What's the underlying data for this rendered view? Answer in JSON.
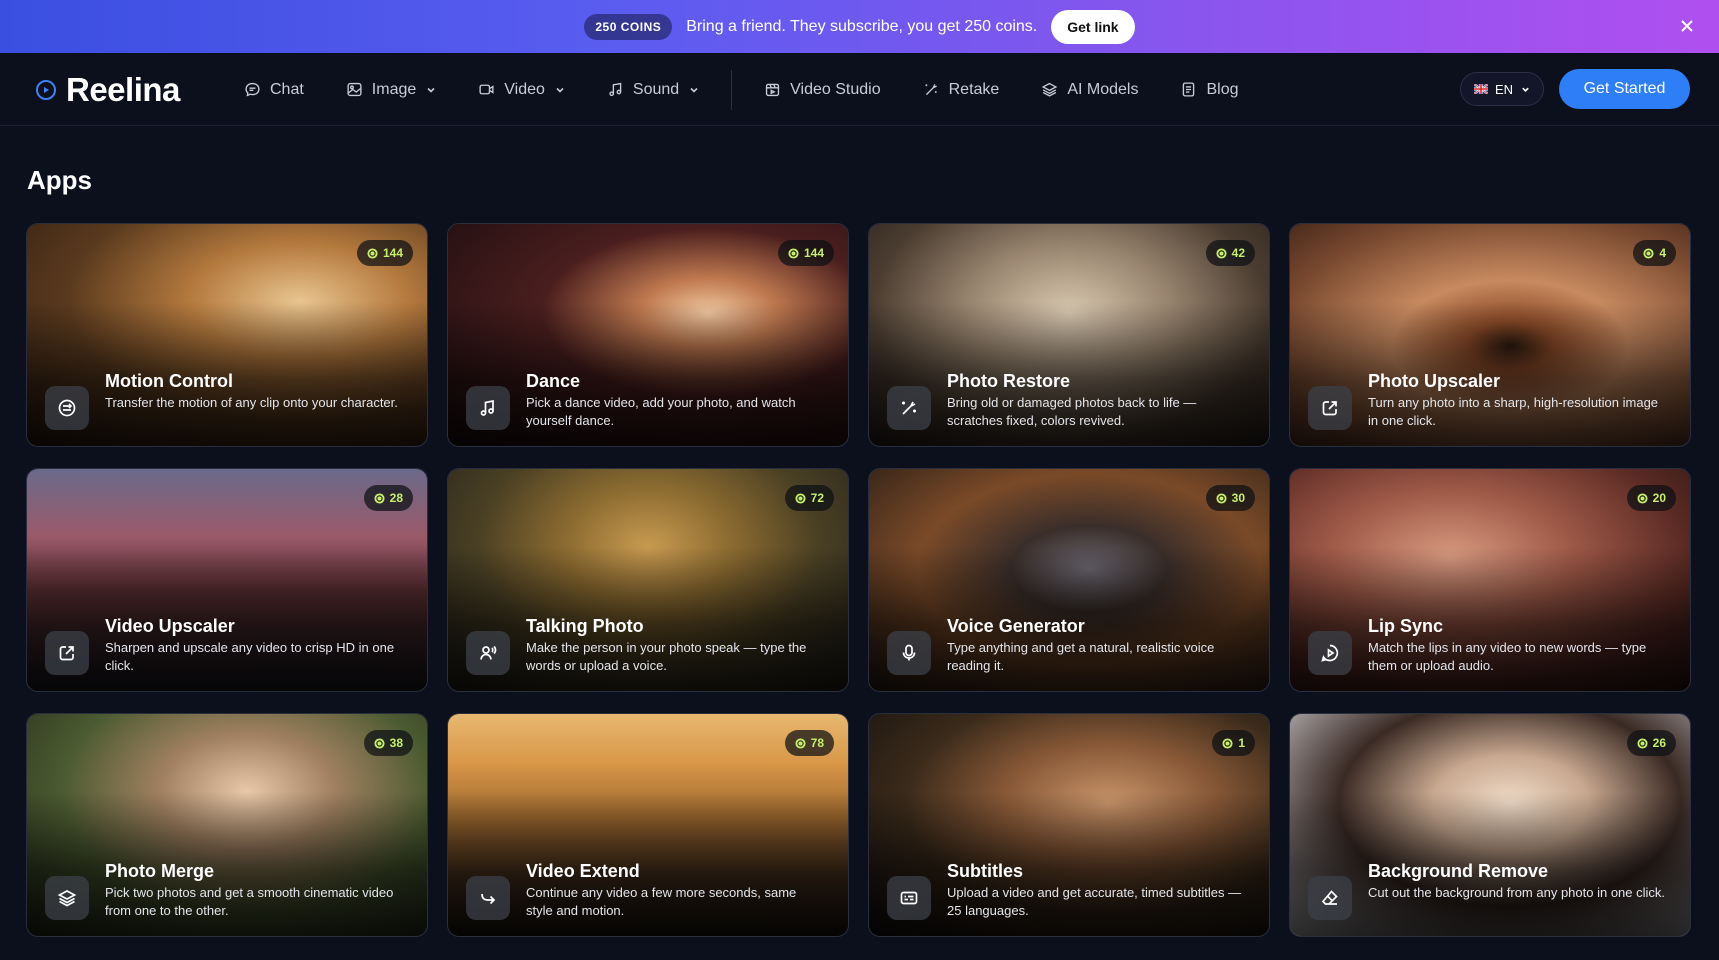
{
  "promo": {
    "badge": "250 COINS",
    "text": "Bring a friend. They subscribe, you get 250 coins.",
    "link_label": "Get link",
    "close_icon": "close-icon"
  },
  "nav": {
    "logo": "Reelina",
    "items": [
      {
        "label": "Chat",
        "icon": "chat-icon",
        "dropdown": false
      },
      {
        "label": "Image",
        "icon": "image-icon",
        "dropdown": true
      },
      {
        "label": "Video",
        "icon": "video-icon",
        "dropdown": true
      },
      {
        "label": "Sound",
        "icon": "music-note-icon",
        "dropdown": true
      },
      {
        "label": "Video Studio",
        "icon": "studio-icon",
        "dropdown": false
      },
      {
        "label": "Retake",
        "icon": "retake-icon",
        "dropdown": false
      },
      {
        "label": "AI Models",
        "icon": "layers-icon",
        "dropdown": false
      },
      {
        "label": "Blog",
        "icon": "document-icon",
        "dropdown": false
      }
    ],
    "language": "EN",
    "cta": "Get Started"
  },
  "section": {
    "title": "Apps"
  },
  "apps": [
    {
      "title": "Motion Control",
      "description": "Transfer the motion of any clip onto your character.",
      "count": "144",
      "icon": "motion-icon",
      "bg": "#5a3a1e"
    },
    {
      "title": "Dance",
      "description": "Pick a dance video, add your photo, and watch yourself dance.",
      "count": "144",
      "icon": "music-note-icon",
      "bg": "#3a1e1e"
    },
    {
      "title": "Photo Restore",
      "description": "Bring old or damaged photos back to life — scratches fixed, colors revived.",
      "count": "42",
      "icon": "magic-wand-icon",
      "bg": "#6a5a48"
    },
    {
      "title": "Photo Upscaler",
      "description": "Turn any photo into a sharp, high-resolution image in one click.",
      "count": "4",
      "icon": "upscale-icon",
      "bg": "#7a4a30"
    },
    {
      "title": "Video Upscaler",
      "description": "Sharpen and upscale any video to crisp HD in one click.",
      "count": "28",
      "icon": "upscale-icon",
      "bg": "#2e2a3a"
    },
    {
      "title": "Talking Photo",
      "description": "Make the person in your photo speak — type the words or upload a voice.",
      "count": "72",
      "icon": "speaking-person-icon",
      "bg": "#4a4024"
    },
    {
      "title": "Voice Generator",
      "description": "Type anything and get a natural, realistic voice reading it.",
      "count": "30",
      "icon": "microphone-icon",
      "bg": "#3a2a1c"
    },
    {
      "title": "Lip Sync",
      "description": "Match the lips in any video to new words — type them or upload audio.",
      "count": "20",
      "icon": "lip-sync-icon",
      "bg": "#6a3a30"
    },
    {
      "title": "Photo Merge",
      "description": "Pick two photos and get a smooth cinematic video from one to the other.",
      "count": "38",
      "icon": "layers-icon",
      "bg": "#3a4a2a"
    },
    {
      "title": "Video Extend",
      "description": "Continue any video a few more seconds, same style and motion.",
      "count": "78",
      "icon": "extend-arrow-icon",
      "bg": "#7a5020"
    },
    {
      "title": "Subtitles",
      "description": "Upload a video and get accurate, timed subtitles — 25 languages.",
      "count": "1",
      "icon": "subtitles-icon",
      "bg": "#3a2a1a"
    },
    {
      "title": "Background Remove",
      "description": "Cut out the background from any photo in one click.",
      "count": "26",
      "icon": "eraser-icon",
      "bg": "#b8b8bc"
    }
  ]
}
